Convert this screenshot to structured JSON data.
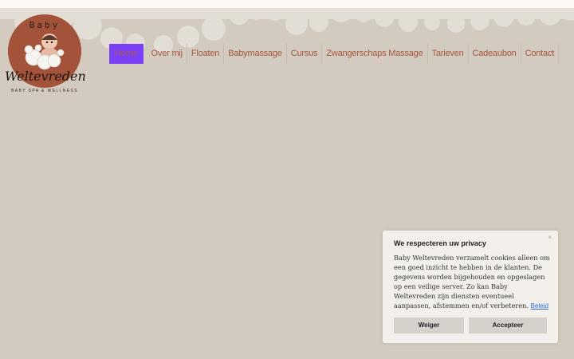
{
  "colors": {
    "background": "#d3cbbf",
    "clouds": "#e0dbd2",
    "logo_circle": "#a2533a",
    "nav_text": "#a4553d",
    "nav_active_bg": "#7b3ff6",
    "cookie_link": "#2c66d2"
  },
  "logo": {
    "top": "Baby",
    "name": "Weltevreden",
    "tagline": "BABY SPA & WELLNESS"
  },
  "nav": {
    "items": [
      {
        "label": "Home",
        "active": true
      },
      {
        "label": "Over mij"
      },
      {
        "label": "Floaten"
      },
      {
        "label": "Babymassage"
      },
      {
        "label": "Cursus"
      },
      {
        "label": "Zwangerschaps Massage"
      },
      {
        "label": "Tarieven"
      },
      {
        "label": "Cadeaubon"
      },
      {
        "label": "Contact"
      }
    ]
  },
  "cookie": {
    "title": "We respecteren uw privacy",
    "close_icon": "×",
    "text": "Baby Weltevreden verzamelt cookies alleen om een goed inzicht te hebben in de klanten. De gegevens worden bijgehouden en opgeslagen op een veilige server. Zo kan Baby Weltevreden zijn diensten eventueel aanpassen, afstemmen en/of verbeteren.",
    "link": "Beleid",
    "deny": "Weiger",
    "accept": "Accepteer"
  }
}
